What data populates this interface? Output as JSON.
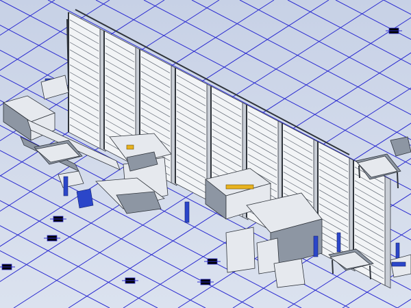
{
  "viewport": {
    "background": "#cdd6e8",
    "grid_color": "#2a2ad0",
    "line_color": "#2e333a"
  },
  "scene": {
    "storage_tower_bays": 9,
    "components": [
      "storage-tower",
      "overhead-gantry",
      "laser-cutting-cell",
      "punch-press-cell",
      "sorting-table",
      "workbench-left",
      "workbench-right",
      "load-station"
    ]
  }
}
